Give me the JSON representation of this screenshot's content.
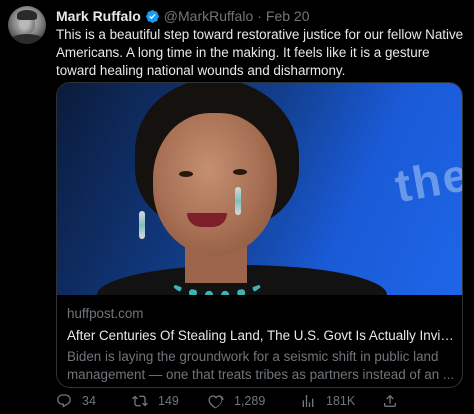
{
  "author": {
    "name": "Mark Ruffalo",
    "handle": "@MarkRuffalo",
    "separator": "·",
    "date": "Feb 20",
    "verified_color": "#1d9bf0"
  },
  "tweet": {
    "text": "This is a beautiful step toward restorative justice for our fellow Native Americans. A long time in the making. It feels like it is a gesture toward healing national wounds and disharmony."
  },
  "card": {
    "domain": "huffpost.com",
    "title": "After Centuries Of Stealing Land, The U.S. Govt Is Actually Inviting Tr...",
    "description": "Biden is laying the groundwork for a seismic shift in public land management — one that treats tribes as partners instead of an ..."
  },
  "actions": {
    "replies": "34",
    "retweets": "149",
    "likes": "1,289",
    "views": "181K"
  },
  "icons": [
    "avatar",
    "verified-badge-icon",
    "reply-icon",
    "retweet-icon",
    "like-icon",
    "views-icon",
    "share-icon"
  ],
  "colors": {
    "background": "#000000",
    "text": "#e7e9ea",
    "muted": "#71767b",
    "border": "#2f3336"
  }
}
